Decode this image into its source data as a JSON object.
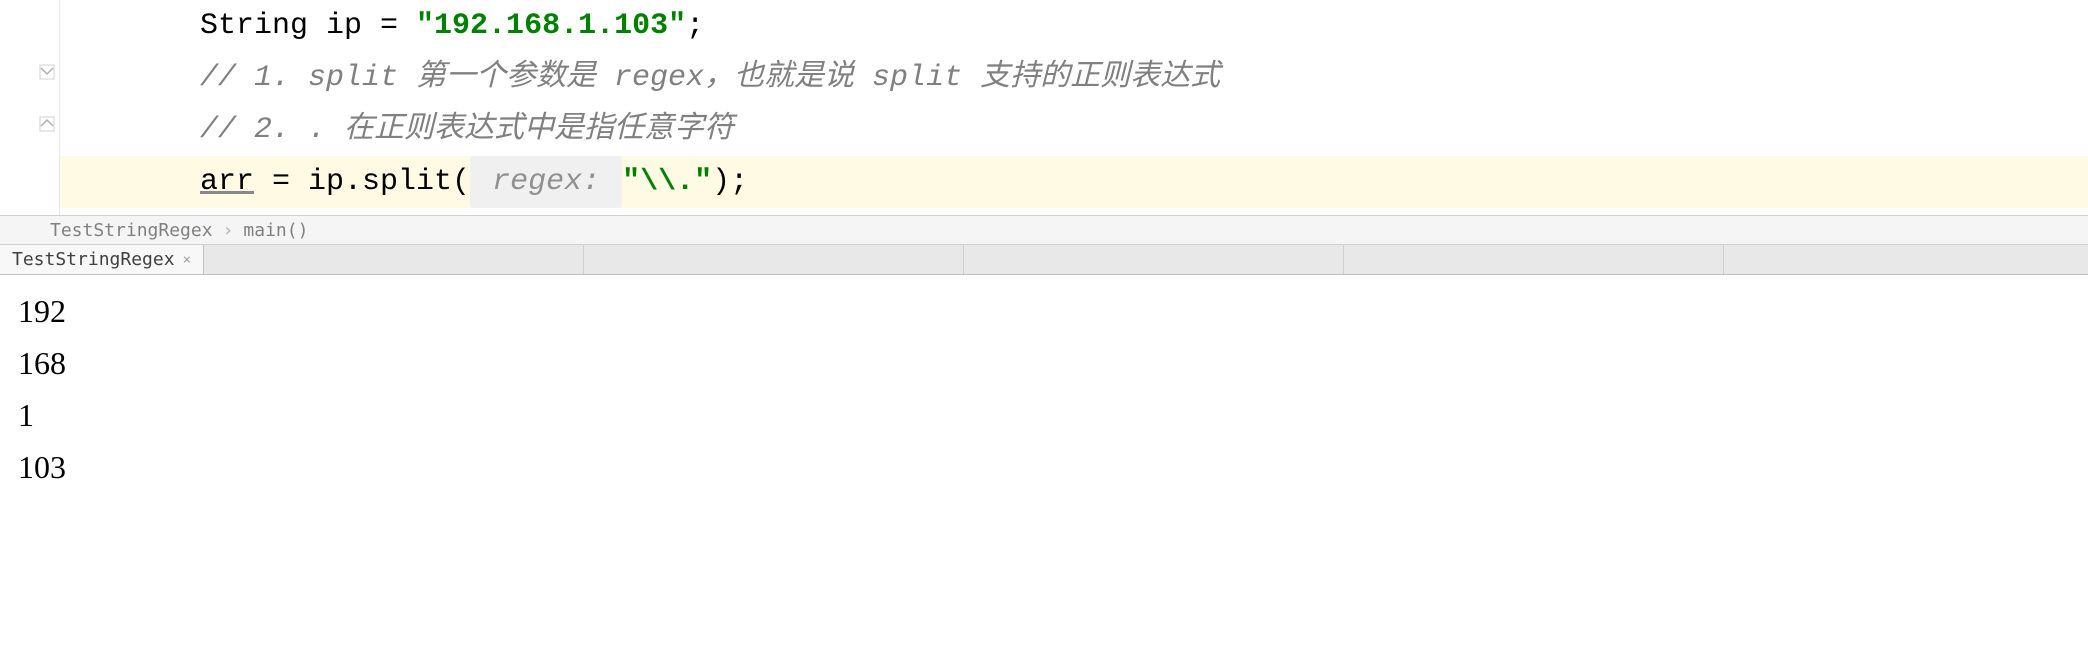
{
  "code": {
    "line1": {
      "prefix": "String ip = ",
      "string": "\"192.168.1.103\"",
      "suffix": ";"
    },
    "line2": "// 1. split 第一个参数是 regex，也就是说 split 支持的正则表达式",
    "line3": "// 2. . 在正则表达式中是指任意字符",
    "line4": {
      "var": "arr",
      "mid": " = ip.split(",
      "hint": " regex: ",
      "string": "\"\\\\.\"",
      "suffix": ");"
    }
  },
  "breadcrumb": {
    "item1": "TestStringRegex",
    "sep": "›",
    "item2": "main()"
  },
  "tab": {
    "label": "TestStringRegex",
    "close": "×"
  },
  "console": {
    "line1": "192",
    "line2": "168",
    "line3": "1",
    "line4": "103"
  }
}
